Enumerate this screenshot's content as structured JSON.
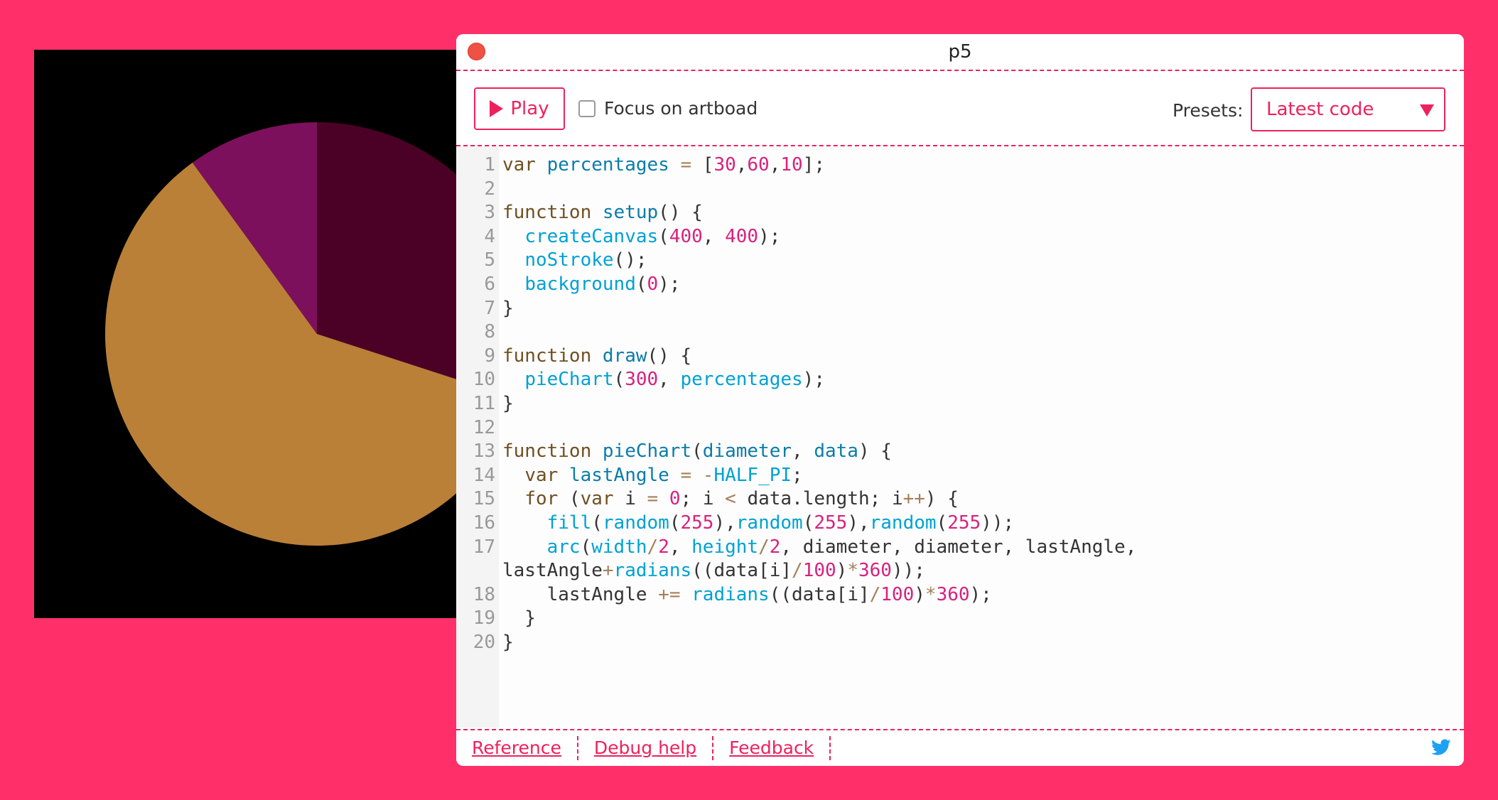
{
  "window": {
    "title": "p5"
  },
  "toolbar": {
    "play_label": "Play",
    "focus_label": "Focus on artboad",
    "focus_checked": false,
    "presets_label": "Presets:",
    "presets_value": "Latest code"
  },
  "artboard": {
    "background": "#000000",
    "chart_data": {
      "type": "pie",
      "values": [
        30,
        60,
        10
      ],
      "start": "-HALF_PI",
      "colors": [
        "#4b0026",
        "#ba8038",
        "#7d105c"
      ]
    }
  },
  "code_lines": [
    "var percentages = [30,60,10];",
    "",
    "function setup() {",
    "  createCanvas(400, 400);",
    "  noStroke();",
    "  background(0);",
    "}",
    "",
    "function draw() {",
    "  pieChart(300, percentages);",
    "}",
    "",
    "function pieChart(diameter, data) {",
    "  var lastAngle = -HALF_PI;",
    "  for (var i = 0; i < data.length; i++) {",
    "    fill(random(255),random(255),random(255));",
    "    arc(width/2, height/2, diameter, diameter, lastAngle, lastAngle+radians((data[i]/100)*360));",
    "    lastAngle += radians((data[i]/100)*360);",
    "  }",
    "}"
  ],
  "footer": {
    "links": [
      "Reference",
      "Debug help",
      "Feedback"
    ],
    "twitter_icon": "twitter-icon",
    "twitter_color": "#1da1f2"
  },
  "colors": {
    "accent": "#ed225d",
    "background": "#ff3069"
  }
}
